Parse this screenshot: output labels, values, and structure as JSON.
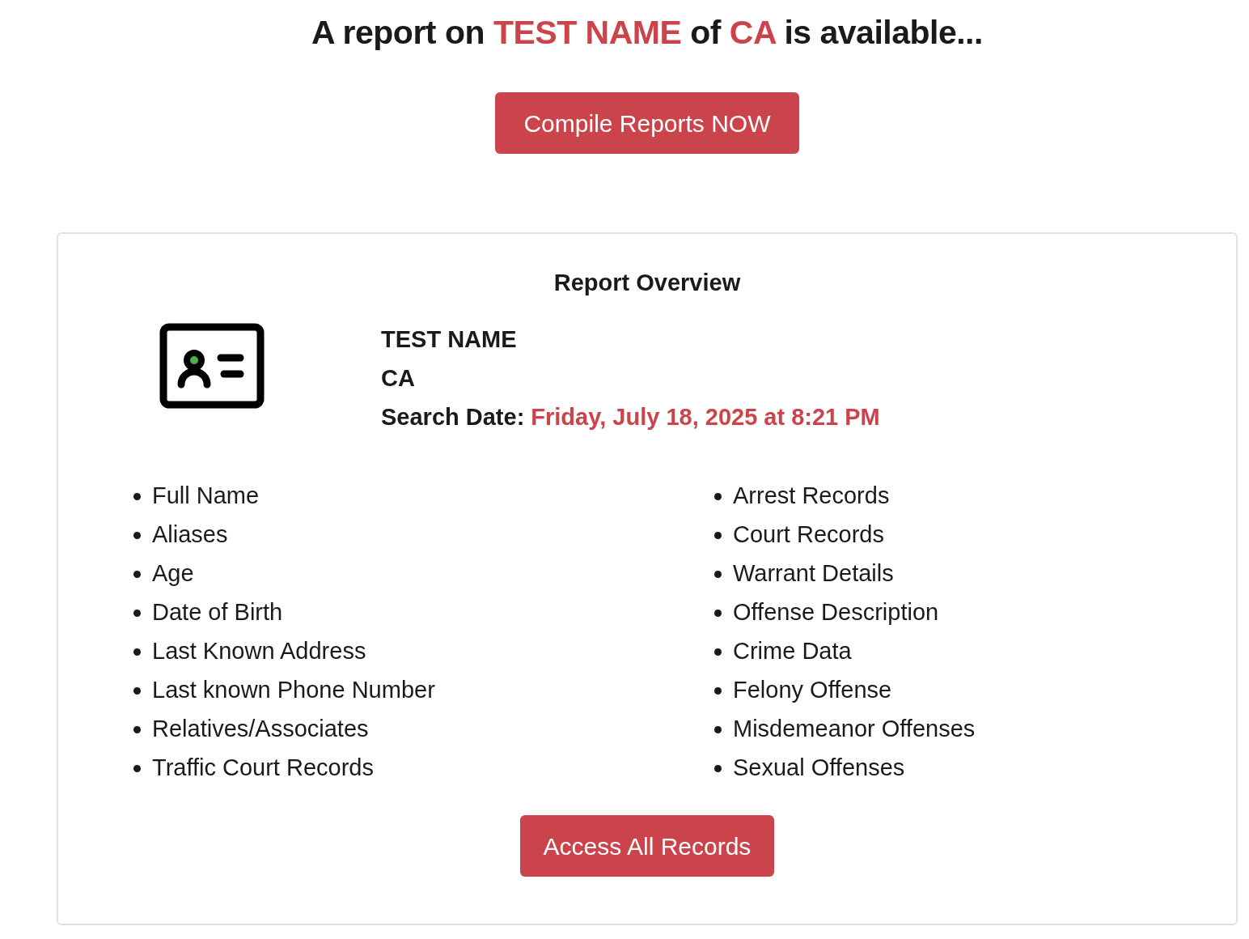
{
  "headline": [
    {
      "text": "A report on ",
      "highlight": false
    },
    {
      "text": "TEST NAME",
      "highlight": true
    },
    {
      "text": " of ",
      "highlight": false
    },
    {
      "text": "CA",
      "highlight": true
    },
    {
      "text": " is available...",
      "highlight": false
    }
  ],
  "compile_button": "Compile Reports NOW",
  "overview": {
    "title": "Report Overview",
    "name": "TEST NAME",
    "state": "CA",
    "search_date_label": "Search Date:",
    "search_date": "Friday, July 18, 2025 at 8:21 PM",
    "left_items": [
      "Full Name",
      "Aliases",
      "Age",
      "Date of Birth",
      "Last Known Address",
      "Last known Phone Number",
      "Relatives/Associates",
      "Traffic Court Records"
    ],
    "right_items": [
      "Arrest Records",
      "Court Records",
      "Warrant Details",
      "Offense Description",
      "Crime Data",
      "Felony Offense",
      "Misdemeanor Offenses",
      "Sexual Offenses"
    ],
    "access_button": "Access All Records"
  }
}
